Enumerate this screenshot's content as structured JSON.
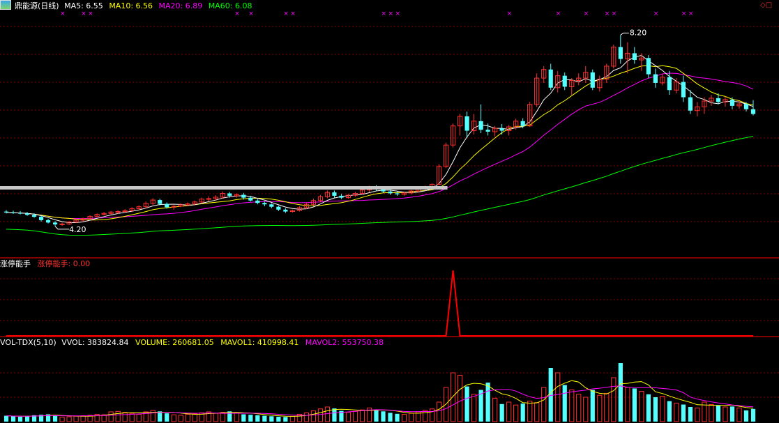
{
  "header": {
    "stock_name": "鼎能源(日线)",
    "ma_items": [
      {
        "label": "MA5: 6.55",
        "color": "#ffffff"
      },
      {
        "label": "MA10: 6.56",
        "color": "#ffff00"
      },
      {
        "label": "MA20: 6.89",
        "color": "#ff00ff"
      },
      {
        "label": "MA60: 6.08",
        "color": "#00ff00"
      }
    ]
  },
  "indicator1": {
    "name": "涨停能手",
    "value_label": "涨停能手: 0.00"
  },
  "indicator2": {
    "name": "VOL-TDX(5,10)",
    "items": [
      {
        "label": "VVOL: 383824.84",
        "color": "#ffffff"
      },
      {
        "label": "VOLUME: 260681.05",
        "color": "#ffff00"
      },
      {
        "label": "MAVOL1: 410998.41",
        "color": "#ffff00"
      },
      {
        "label": "MAVOL2: 553750.38",
        "color": "#ff00ff"
      }
    ]
  },
  "annotations": {
    "high_price_label": "8.20",
    "low_price_label": "4.20"
  },
  "colors": {
    "up": "#ff3232",
    "down": "#54ffff",
    "grid": "#8b0000",
    "signal": "#ff0000",
    "marker": "#ff00ff"
  },
  "chart_data": [
    {
      "type": "candlestick",
      "title": "鼎能源(日线)",
      "ylim": [
        3.6,
        8.7
      ],
      "notes": "Daily candles approximated from the image, ordered left to right.",
      "candles": [
        {
          "o": 4.51,
          "h": 4.54,
          "l": 4.47,
          "c": 4.49
        },
        {
          "o": 4.49,
          "h": 4.53,
          "l": 4.46,
          "c": 4.48
        },
        {
          "o": 4.48,
          "h": 4.52,
          "l": 4.45,
          "c": 4.47
        },
        {
          "o": 4.47,
          "h": 4.5,
          "l": 4.42,
          "c": 4.44
        },
        {
          "o": 4.44,
          "h": 4.47,
          "l": 4.38,
          "c": 4.4
        },
        {
          "o": 4.4,
          "h": 4.42,
          "l": 4.3,
          "c": 4.33
        },
        {
          "o": 4.33,
          "h": 4.36,
          "l": 4.26,
          "c": 4.28
        },
        {
          "o": 4.28,
          "h": 4.31,
          "l": 4.2,
          "c": 4.24
        },
        {
          "o": 4.24,
          "h": 4.28,
          "l": 4.21,
          "c": 4.25
        },
        {
          "o": 4.25,
          "h": 4.31,
          "l": 4.23,
          "c": 4.29
        },
        {
          "o": 4.29,
          "h": 4.35,
          "l": 4.27,
          "c": 4.33
        },
        {
          "o": 4.33,
          "h": 4.38,
          "l": 4.3,
          "c": 4.36
        },
        {
          "o": 4.36,
          "h": 4.43,
          "l": 4.34,
          "c": 4.41
        },
        {
          "o": 4.41,
          "h": 4.47,
          "l": 4.39,
          "c": 4.45
        },
        {
          "o": 4.45,
          "h": 4.5,
          "l": 4.43,
          "c": 4.47
        },
        {
          "o": 4.47,
          "h": 4.52,
          "l": 4.44,
          "c": 4.5
        },
        {
          "o": 4.5,
          "h": 4.54,
          "l": 4.46,
          "c": 4.51
        },
        {
          "o": 4.51,
          "h": 4.56,
          "l": 4.48,
          "c": 4.53
        },
        {
          "o": 4.53,
          "h": 4.6,
          "l": 4.5,
          "c": 4.57
        },
        {
          "o": 4.57,
          "h": 4.64,
          "l": 4.54,
          "c": 4.61
        },
        {
          "o": 4.61,
          "h": 4.72,
          "l": 4.58,
          "c": 4.68
        },
        {
          "o": 4.68,
          "h": 4.79,
          "l": 4.65,
          "c": 4.75
        },
        {
          "o": 4.75,
          "h": 4.78,
          "l": 4.64,
          "c": 4.67
        },
        {
          "o": 4.67,
          "h": 4.7,
          "l": 4.57,
          "c": 4.6
        },
        {
          "o": 4.6,
          "h": 4.64,
          "l": 4.55,
          "c": 4.62
        },
        {
          "o": 4.62,
          "h": 4.68,
          "l": 4.6,
          "c": 4.65
        },
        {
          "o": 4.65,
          "h": 4.7,
          "l": 4.62,
          "c": 4.67
        },
        {
          "o": 4.67,
          "h": 4.74,
          "l": 4.64,
          "c": 4.71
        },
        {
          "o": 4.71,
          "h": 4.8,
          "l": 4.68,
          "c": 4.77
        },
        {
          "o": 4.77,
          "h": 4.83,
          "l": 4.72,
          "c": 4.78
        },
        {
          "o": 4.78,
          "h": 4.85,
          "l": 4.74,
          "c": 4.81
        },
        {
          "o": 4.81,
          "h": 4.93,
          "l": 4.78,
          "c": 4.89
        },
        {
          "o": 4.89,
          "h": 4.92,
          "l": 4.8,
          "c": 4.84
        },
        {
          "o": 4.84,
          "h": 4.89,
          "l": 4.8,
          "c": 4.86
        },
        {
          "o": 4.86,
          "h": 4.9,
          "l": 4.76,
          "c": 4.8
        },
        {
          "o": 4.8,
          "h": 4.84,
          "l": 4.72,
          "c": 4.74
        },
        {
          "o": 4.74,
          "h": 4.77,
          "l": 4.66,
          "c": 4.69
        },
        {
          "o": 4.69,
          "h": 4.72,
          "l": 4.62,
          "c": 4.66
        },
        {
          "o": 4.66,
          "h": 4.68,
          "l": 4.58,
          "c": 4.61
        },
        {
          "o": 4.61,
          "h": 4.63,
          "l": 4.52,
          "c": 4.55
        },
        {
          "o": 4.55,
          "h": 4.58,
          "l": 4.48,
          "c": 4.51
        },
        {
          "o": 4.51,
          "h": 4.55,
          "l": 4.49,
          "c": 4.53
        },
        {
          "o": 4.53,
          "h": 4.62,
          "l": 4.51,
          "c": 4.59
        },
        {
          "o": 4.59,
          "h": 4.69,
          "l": 4.56,
          "c": 4.66
        },
        {
          "o": 4.66,
          "h": 4.78,
          "l": 4.63,
          "c": 4.74
        },
        {
          "o": 4.74,
          "h": 4.86,
          "l": 4.7,
          "c": 4.82
        },
        {
          "o": 4.82,
          "h": 4.95,
          "l": 4.79,
          "c": 4.91
        },
        {
          "o": 4.91,
          "h": 4.95,
          "l": 4.8,
          "c": 4.84
        },
        {
          "o": 4.84,
          "h": 4.88,
          "l": 4.77,
          "c": 4.8
        },
        {
          "o": 4.8,
          "h": 4.88,
          "l": 4.78,
          "c": 4.85
        },
        {
          "o": 4.85,
          "h": 4.92,
          "l": 4.82,
          "c": 4.89
        },
        {
          "o": 4.89,
          "h": 5.0,
          "l": 4.86,
          "c": 4.96
        },
        {
          "o": 4.96,
          "h": 5.05,
          "l": 4.92,
          "c": 5.02
        },
        {
          "o": 5.02,
          "h": 5.06,
          "l": 4.94,
          "c": 4.98
        },
        {
          "o": 4.98,
          "h": 5.02,
          "l": 4.9,
          "c": 4.93
        },
        {
          "o": 4.93,
          "h": 4.97,
          "l": 4.86,
          "c": 4.89
        },
        {
          "o": 4.89,
          "h": 4.93,
          "l": 4.84,
          "c": 4.87
        },
        {
          "o": 4.87,
          "h": 4.92,
          "l": 4.84,
          "c": 4.9
        },
        {
          "o": 4.9,
          "h": 4.96,
          "l": 4.87,
          "c": 4.94
        },
        {
          "o": 4.94,
          "h": 5.0,
          "l": 4.91,
          "c": 4.98
        },
        {
          "o": 4.98,
          "h": 5.05,
          "l": 4.95,
          "c": 5.03
        },
        {
          "o": 5.03,
          "h": 5.1,
          "l": 5.0,
          "c": 5.08
        },
        {
          "o": 5.08,
          "h": 5.5,
          "l": 5.06,
          "c": 5.45
        },
        {
          "o": 5.45,
          "h": 5.95,
          "l": 5.42,
          "c": 5.9
        },
        {
          "o": 5.9,
          "h": 6.35,
          "l": 5.85,
          "c": 6.3
        },
        {
          "o": 6.3,
          "h": 6.55,
          "l": 6.1,
          "c": 6.5
        },
        {
          "o": 6.5,
          "h": 6.6,
          "l": 6.05,
          "c": 6.2
        },
        {
          "o": 6.2,
          "h": 6.55,
          "l": 6.12,
          "c": 6.4
        },
        {
          "o": 6.4,
          "h": 6.75,
          "l": 6.15,
          "c": 6.22
        },
        {
          "o": 6.22,
          "h": 6.35,
          "l": 6.1,
          "c": 6.18
        },
        {
          "o": 6.18,
          "h": 6.3,
          "l": 6.08,
          "c": 6.25
        },
        {
          "o": 6.25,
          "h": 6.34,
          "l": 6.12,
          "c": 6.2
        },
        {
          "o": 6.2,
          "h": 6.32,
          "l": 6.1,
          "c": 6.28
        },
        {
          "o": 6.28,
          "h": 6.45,
          "l": 6.22,
          "c": 6.4
        },
        {
          "o": 6.4,
          "h": 6.46,
          "l": 6.25,
          "c": 6.3
        },
        {
          "o": 6.3,
          "h": 6.8,
          "l": 6.28,
          "c": 6.75
        },
        {
          "o": 6.75,
          "h": 7.4,
          "l": 6.7,
          "c": 7.3
        },
        {
          "o": 7.3,
          "h": 7.55,
          "l": 7.2,
          "c": 7.48
        },
        {
          "o": 7.48,
          "h": 7.6,
          "l": 7.05,
          "c": 7.1
        },
        {
          "o": 7.1,
          "h": 7.45,
          "l": 7.0,
          "c": 7.35
        },
        {
          "o": 7.35,
          "h": 7.42,
          "l": 7.05,
          "c": 7.12
        },
        {
          "o": 7.12,
          "h": 7.3,
          "l": 6.95,
          "c": 7.25
        },
        {
          "o": 7.25,
          "h": 7.4,
          "l": 7.15,
          "c": 7.3
        },
        {
          "o": 7.3,
          "h": 7.55,
          "l": 7.2,
          "c": 7.42
        },
        {
          "o": 7.42,
          "h": 7.48,
          "l": 7.05,
          "c": 7.1
        },
        {
          "o": 7.1,
          "h": 7.35,
          "l": 7.02,
          "c": 7.28
        },
        {
          "o": 7.28,
          "h": 7.6,
          "l": 7.2,
          "c": 7.55
        },
        {
          "o": 7.55,
          "h": 8.0,
          "l": 7.5,
          "c": 7.95
        },
        {
          "o": 7.95,
          "h": 8.2,
          "l": 7.6,
          "c": 7.7
        },
        {
          "o": 7.7,
          "h": 8.05,
          "l": 7.4,
          "c": 7.82
        },
        {
          "o": 7.82,
          "h": 7.95,
          "l": 7.6,
          "c": 7.68
        },
        {
          "o": 7.68,
          "h": 7.82,
          "l": 7.45,
          "c": 7.72
        },
        {
          "o": 7.72,
          "h": 7.78,
          "l": 7.3,
          "c": 7.38
        },
        {
          "o": 7.38,
          "h": 7.5,
          "l": 7.1,
          "c": 7.2
        },
        {
          "o": 7.2,
          "h": 7.38,
          "l": 7.15,
          "c": 7.32
        },
        {
          "o": 7.32,
          "h": 7.45,
          "l": 6.95,
          "c": 7.05
        },
        {
          "o": 7.05,
          "h": 7.3,
          "l": 6.98,
          "c": 7.22
        },
        {
          "o": 7.22,
          "h": 7.35,
          "l": 6.8,
          "c": 6.9
        },
        {
          "o": 6.9,
          "h": 7.05,
          "l": 6.55,
          "c": 6.62
        },
        {
          "o": 6.62,
          "h": 6.8,
          "l": 6.5,
          "c": 6.7
        },
        {
          "o": 6.7,
          "h": 6.9,
          "l": 6.55,
          "c": 6.82
        },
        {
          "o": 6.82,
          "h": 6.95,
          "l": 6.72,
          "c": 6.88
        },
        {
          "o": 6.88,
          "h": 6.98,
          "l": 6.75,
          "c": 6.8
        },
        {
          "o": 6.8,
          "h": 6.92,
          "l": 6.7,
          "c": 6.85
        },
        {
          "o": 6.85,
          "h": 6.9,
          "l": 6.65,
          "c": 6.72
        },
        {
          "o": 6.72,
          "h": 6.82,
          "l": 6.66,
          "c": 6.76
        },
        {
          "o": 6.76,
          "h": 6.8,
          "l": 6.6,
          "c": 6.65
        },
        {
          "o": 6.65,
          "h": 6.84,
          "l": 6.52,
          "c": 6.55
        }
      ]
    },
    {
      "type": "line",
      "title": "涨停能手",
      "ylim": [
        0,
        1
      ],
      "series": [
        {
          "name": "涨停能手",
          "values": [
            0,
            0,
            0,
            0,
            0,
            0,
            0,
            0,
            0,
            0,
            0,
            0,
            0,
            0,
            0,
            0,
            0,
            0,
            0,
            0,
            0,
            0,
            0,
            0,
            0,
            0,
            0,
            0,
            0,
            0,
            0,
            0,
            0,
            0,
            0,
            0,
            0,
            0,
            0,
            0,
            0,
            0,
            0,
            0,
            0,
            0,
            0,
            0,
            0,
            0,
            0,
            0,
            0,
            0,
            0,
            0,
            0,
            0,
            0,
            0,
            0,
            0,
            0,
            0,
            1,
            0,
            0,
            0,
            0,
            0,
            0,
            0,
            0,
            0,
            0,
            0,
            0,
            0,
            0,
            0,
            0,
            0,
            0,
            0,
            0,
            0,
            0,
            0,
            0,
            0,
            0,
            0,
            0,
            0,
            0,
            0,
            0,
            0,
            0,
            0,
            0,
            0,
            0,
            0,
            0,
            0,
            0,
            0
          ]
        }
      ]
    },
    {
      "type": "bar",
      "title": "VOL-TDX(5,10)",
      "ylim": [
        0,
        1500000
      ],
      "volumes": [
        120000,
        110000,
        100000,
        115000,
        130000,
        140000,
        150000,
        120000,
        90000,
        100000,
        110000,
        120000,
        130000,
        150000,
        140000,
        200000,
        210000,
        190000,
        170000,
        150000,
        200000,
        230000,
        210000,
        170000,
        140000,
        130000,
        150000,
        160000,
        180000,
        200000,
        170000,
        190000,
        210000,
        180000,
        150000,
        140000,
        130000,
        120000,
        110000,
        100000,
        95000,
        110000,
        150000,
        180000,
        220000,
        260000,
        300000,
        270000,
        220000,
        190000,
        210000,
        240000,
        280000,
        250000,
        210000,
        180000,
        160000,
        150000,
        170000,
        200000,
        230000,
        260000,
        400000,
        700000,
        1000000,
        950000,
        720000,
        560000,
        650000,
        800000,
        480000,
        360000,
        400000,
        340000,
        370000,
        420000,
        390000,
        700000,
        1100000,
        1000000,
        750000,
        650000,
        560000,
        500000,
        650000,
        540000,
        580000,
        900000,
        1200000,
        700000,
        680000,
        620000,
        560000,
        500000,
        520000,
        420000,
        380000,
        350000,
        300000,
        280000,
        400000,
        350000,
        330000,
        300000,
        310000,
        280000,
        230000,
        260000
      ]
    }
  ]
}
